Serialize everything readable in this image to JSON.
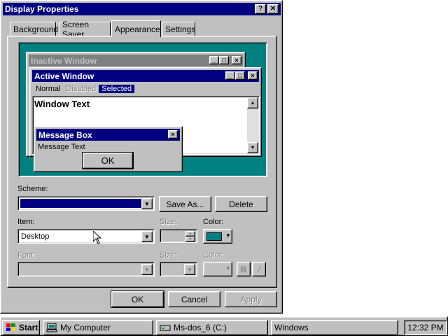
{
  "dialog": {
    "title": "Display Properties",
    "help_glyph": "?",
    "close_glyph": "✕",
    "tabs": [
      {
        "label": "Background"
      },
      {
        "label": "Screen Saver"
      },
      {
        "label": "Appearance"
      },
      {
        "label": "Settings"
      }
    ],
    "active_tab": "Appearance"
  },
  "preview": {
    "inactive_title": "Inactive Window",
    "active_title": "Active Window",
    "menu": {
      "normal": "Normal",
      "disabled": "Disabled",
      "selected": "Selected"
    },
    "window_text": "Window Text",
    "msgbox_title": "Message Box",
    "msgbox_text": "Message Text",
    "msgbox_ok": "OK"
  },
  "appearance": {
    "scheme_label": "Scheme:",
    "scheme_value": "",
    "save_as": "Save As...",
    "delete": "Delete",
    "item_label": "Item:",
    "item_value": "Desktop",
    "size_label": "Size:",
    "color_label": "Color:",
    "item_color": "#008080",
    "font_label": "Font:",
    "font_size_label": "Size:",
    "font_color_label": "Color:",
    "bold": "B",
    "italic": "/"
  },
  "buttons": {
    "ok": "OK",
    "cancel": "Cancel",
    "apply": "Apply"
  },
  "taskbar": {
    "start": "Start",
    "tasks": [
      {
        "label": "My Computer"
      },
      {
        "label": "Ms-dos_6 (C:)"
      },
      {
        "label": "Windows"
      }
    ],
    "clock": "12:32 PM"
  },
  "colors": {
    "title_active": "#000080",
    "title_inactive": "#808080",
    "desktop": "#008080",
    "face": "#c0c0c0"
  }
}
